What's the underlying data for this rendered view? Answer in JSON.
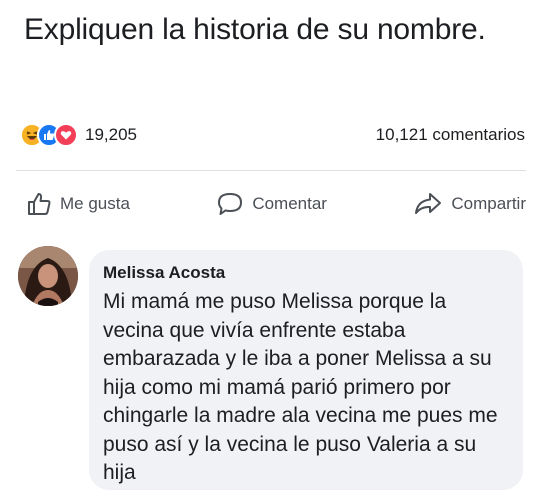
{
  "post": {
    "text": "Expliquen la historia de su nombre."
  },
  "reactions": {
    "icons": [
      "haha-reaction-icon",
      "like-reaction-icon",
      "love-reaction-icon"
    ],
    "count": "19,205",
    "comments": "10,121 comentarios"
  },
  "actions": {
    "like_label": "Me gusta",
    "comment_label": "Comentar",
    "share_label": "Compartir"
  },
  "comment": {
    "author": "Melissa Acosta",
    "text": "Mi mamá me puso Melissa porque la vecina que vivía enfrente estaba embarazada y le iba a poner Melissa a su hija como mi mamá parió primero por chingarle la madre ala vecina me pues me puso así y la vecina le puso Valeria a su hija"
  },
  "colors": {
    "like_blue": "#1877f2",
    "love_red": "#f33e58",
    "haha_yellow": "#f7b125",
    "bubble_gray": "#f0f2f5"
  }
}
